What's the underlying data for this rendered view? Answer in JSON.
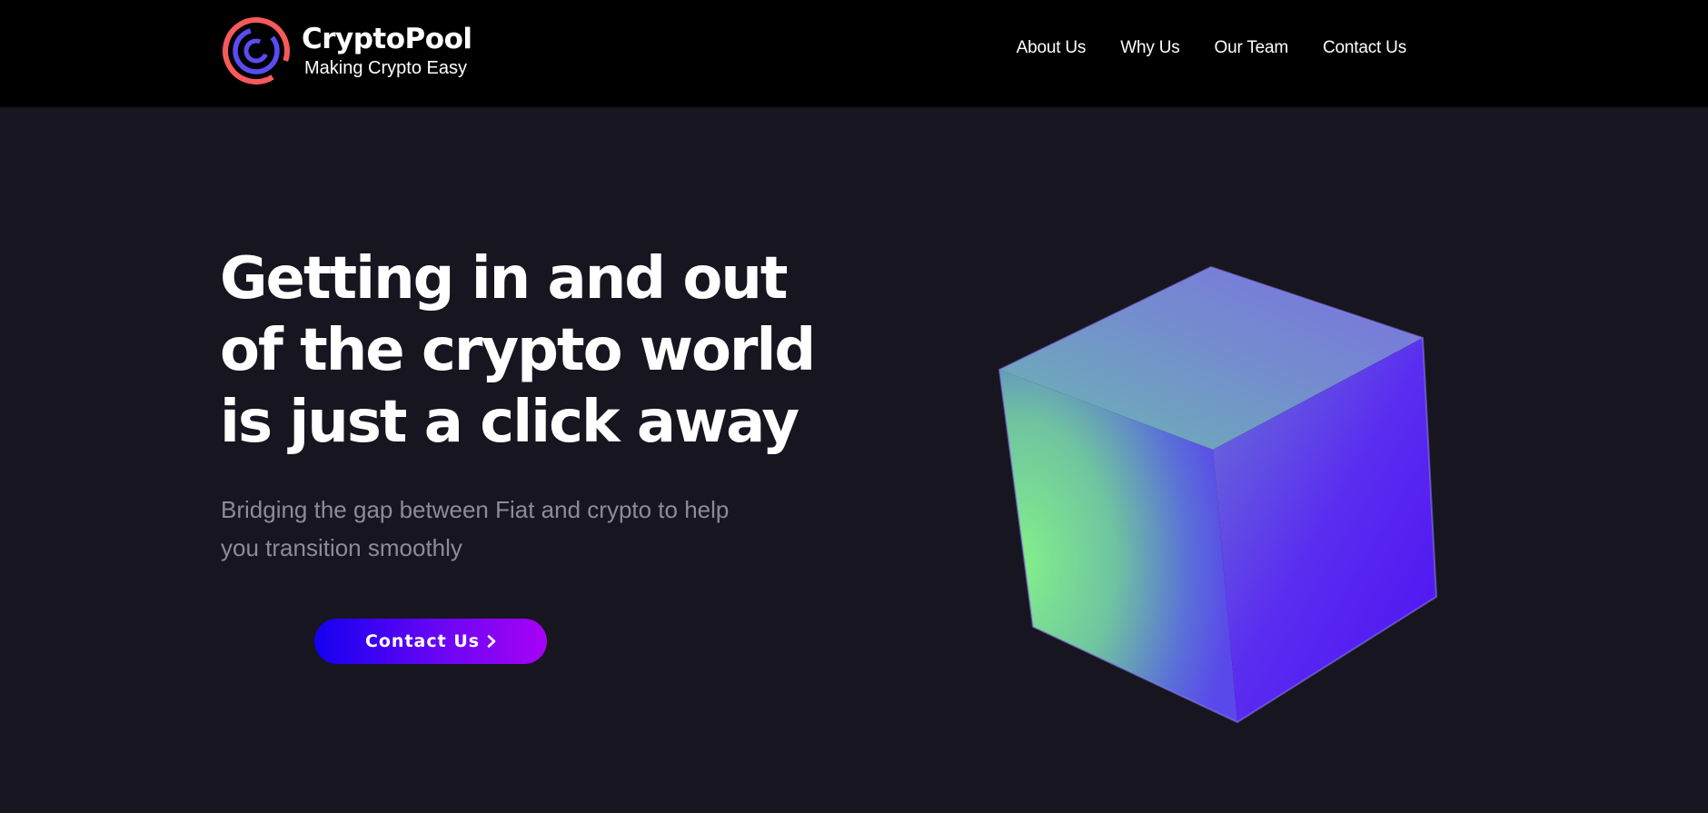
{
  "brand": {
    "name": "CryptoPool",
    "tagline": "Making Crypto Easy"
  },
  "nav": {
    "items": [
      "About Us",
      "Why Us",
      "Our Team",
      "Contact Us"
    ]
  },
  "hero": {
    "title": "Getting in and out of the crypto world is just a click away",
    "subtitle": "Bridging the gap between Fiat and crypto to help you transition smoothly",
    "cta_label": "Contact Us"
  },
  "icons": {
    "logo": "cryptopool-ring-logo",
    "cta_arrow": "chevron-right-icon",
    "hero_graphic": "gradient-cube"
  },
  "colors": {
    "background": "#17151f",
    "navbar": "#000000",
    "text": "#ffffff",
    "subtitle": "#8e8b98",
    "logo_outer": "#f85a5a",
    "logo_inner": "#5b4bf2",
    "cta_start": "#1400f0",
    "cta_end": "#a702f5",
    "cube_green": "#7ee88a",
    "cube_violet": "#5512f2"
  }
}
